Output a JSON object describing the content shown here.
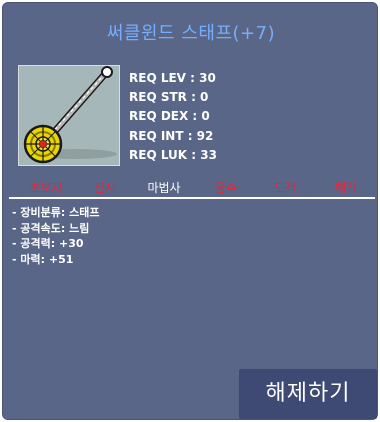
{
  "item": {
    "name": "써클윈드 스태프(+7)",
    "name_color": "#74aefc",
    "icon": "circle-wind-staff-icon"
  },
  "requirements": {
    "lev": "REQ LEV : 30",
    "str": "REQ STR : 0",
    "dex": "REQ DEX : 0",
    "int": "REQ INT : 92",
    "luk": "REQ LUK : 33"
  },
  "jobs": [
    {
      "label": "초보자",
      "allowed": false
    },
    {
      "label": "전사",
      "allowed": false
    },
    {
      "label": "마법사",
      "allowed": true
    },
    {
      "label": "궁수",
      "allowed": false
    },
    {
      "label": "도적",
      "allowed": false
    },
    {
      "label": "해적",
      "allowed": false
    }
  ],
  "colors": {
    "background": "#5a6688",
    "disallowed_job": "#ee2233",
    "allowed_job": "#ffffff",
    "button": "#3e4a73"
  },
  "stats": {
    "category": "- 장비분류: 스태프",
    "attack_speed": "- 공격속도: 느림",
    "attack": "- 공격력: +30",
    "magic": "- 마력: +51"
  },
  "button": {
    "label": "해제하기"
  }
}
